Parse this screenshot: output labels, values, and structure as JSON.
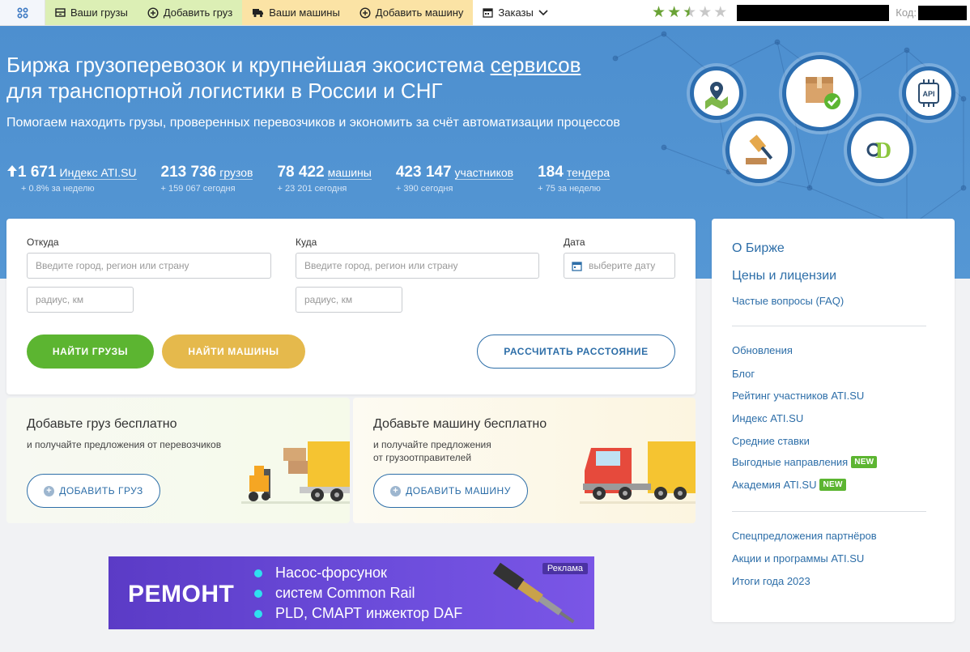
{
  "topbar": {
    "items": [
      {
        "label": "Ваши грузы",
        "icon": "cargo-box-icon"
      },
      {
        "label": "Добавить груз",
        "icon": "plus-circle-icon"
      },
      {
        "label": "Ваши машины",
        "icon": "truck-icon"
      },
      {
        "label": "Добавить машину",
        "icon": "plus-circle-icon"
      },
      {
        "label": "Заказы",
        "icon": "calendar-icon"
      }
    ],
    "rating": 2.5,
    "code_label": "Код:"
  },
  "hero": {
    "title_part1": "Биржа грузоперевозок и крупнейшая экосистема ",
    "title_link": "сервисов",
    "title_part2": "для транспортной логистики в России и СНГ",
    "subtitle": "Помогаем находить грузы, проверенных перевозчиков и экономить за счёт автоматизации процессов",
    "stats": [
      {
        "value": "1 671",
        "label": "Индекс ATI.SU",
        "delta": "+ 0.8% за неделю"
      },
      {
        "value": "213 736",
        "label": "грузов",
        "delta": "+ 159 067 сегодня"
      },
      {
        "value": "78 422",
        "label": "машины",
        "delta": "+ 23 201 сегодня"
      },
      {
        "value": "423 147",
        "label": "участников",
        "delta": "+ 390 сегодня"
      },
      {
        "value": "184",
        "label": "тендера",
        "delta": "+ 75 за неделю"
      }
    ],
    "api_label": "API",
    "d_label": "D"
  },
  "search": {
    "from_label": "Откуда",
    "to_label": "Куда",
    "date_label": "Дата",
    "city_placeholder": "Введите город, регион или страну",
    "radius_placeholder": "радиус, км",
    "date_placeholder": "выберите дату",
    "find_cargo": "НАЙТИ ГРУЗЫ",
    "find_trucks": "НАЙТИ МАШИНЫ",
    "calc_distance": "РАССЧИТАТЬ РАССТОЯНИЕ"
  },
  "promo_cargo": {
    "title": "Добавьте груз бесплатно",
    "subtitle": "и получайте предложения от перевозчиков",
    "button": "ДОБАВИТЬ ГРУЗ"
  },
  "promo_truck": {
    "title": "Добавьте машину бесплатно",
    "subtitle_line1": "и получайте предложения",
    "subtitle_line2": "от грузоотправителей",
    "button": "ДОБАВИТЬ МАШИНУ"
  },
  "ad": {
    "headline": "РЕМОНТ",
    "bullets": [
      "Насос-форсунок",
      "систем Common Rail",
      "PLD, СМАРТ инжектор DAF"
    ],
    "tag": "Реклама"
  },
  "sidebar": {
    "about": "О Бирже",
    "prices": "Цены и лицензии",
    "faq": "Частые вопросы (FAQ)",
    "links": [
      {
        "label": "Обновления"
      },
      {
        "label": "Блог"
      },
      {
        "label": "Рейтинг участников ATI.SU"
      },
      {
        "label": "Индекс ATI.SU"
      },
      {
        "label": "Средние ставки"
      },
      {
        "label": "Выгодные направления",
        "badge": "NEW"
      },
      {
        "label": "Академия ATI.SU",
        "badge": "NEW"
      }
    ],
    "links2": [
      "Спецпредложения партнёров",
      "Акции и программы ATI.SU",
      "Итоги года 2023"
    ]
  }
}
